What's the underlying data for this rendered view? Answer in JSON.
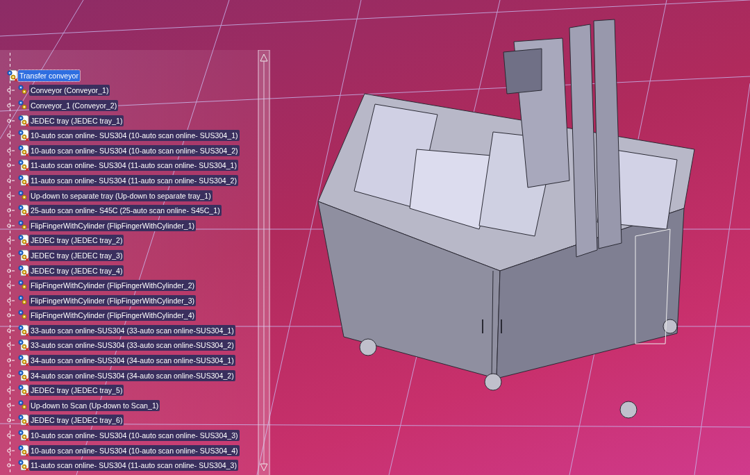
{
  "tree": {
    "label": "Transfer conveyor",
    "selected": true,
    "children": [
      {
        "label": "Conveyor (Conveyor_1)",
        "kind": "component",
        "selected": false
      },
      {
        "label": "Conveyor_1 (Conveyor_2)",
        "kind": "component",
        "selected": false
      },
      {
        "label": "JEDEC tray (JEDEC tray_1)",
        "kind": "part",
        "selected": false
      },
      {
        "label": "10-auto scan online- SUS304 (10-auto scan online- SUS304_1)",
        "kind": "part",
        "selected": false
      },
      {
        "label": "10-auto scan online- SUS304 (10-auto scan online- SUS304_2)",
        "kind": "part",
        "selected": false
      },
      {
        "label": "11-auto scan online- SUS304 (11-auto scan online- SUS304_1)",
        "kind": "part",
        "selected": false
      },
      {
        "label": "11-auto scan online- SUS304 (11-auto scan online- SUS304_2)",
        "kind": "part",
        "selected": false
      },
      {
        "label": "Up-down to separate tray (Up-down to separate tray_1)",
        "kind": "component",
        "selected": false
      },
      {
        "label": "25-auto scan online- S45C (25-auto scan online- S45C_1)",
        "kind": "part",
        "selected": false
      },
      {
        "label": "FlipFingerWithCylinder (FlipFingerWithCylinder_1)",
        "kind": "component",
        "selected": false
      },
      {
        "label": "JEDEC tray (JEDEC tray_2)",
        "kind": "part",
        "selected": false
      },
      {
        "label": "JEDEC tray (JEDEC tray_3)",
        "kind": "part",
        "selected": false
      },
      {
        "label": "JEDEC tray (JEDEC tray_4)",
        "kind": "part",
        "selected": false
      },
      {
        "label": "FlipFingerWithCylinder (FlipFingerWithCylinder_2)",
        "kind": "component",
        "selected": false
      },
      {
        "label": "FlipFingerWithCylinder (FlipFingerWithCylinder_3)",
        "kind": "component",
        "selected": false
      },
      {
        "label": "FlipFingerWithCylinder (FlipFingerWithCylinder_4)",
        "kind": "component",
        "selected": false
      },
      {
        "label": "33-auto scan online-SUS304 (33-auto scan online-SUS304_1)",
        "kind": "part",
        "selected": false
      },
      {
        "label": "33-auto scan online-SUS304 (33-auto scan online-SUS304_2)",
        "kind": "part",
        "selected": false
      },
      {
        "label": "34-auto scan online-SUS304 (34-auto scan online-SUS304_1)",
        "kind": "part",
        "selected": false
      },
      {
        "label": "34-auto scan online-SUS304 (34-auto scan online-SUS304_2)",
        "kind": "part",
        "selected": false
      },
      {
        "label": "JEDEC tray (JEDEC tray_5)",
        "kind": "part",
        "selected": false
      },
      {
        "label": "Up-down to Scan (Up-down to Scan_1)",
        "kind": "component",
        "selected": false
      },
      {
        "label": "JEDEC tray (JEDEC tray_6)",
        "kind": "part",
        "selected": false
      },
      {
        "label": "10-auto scan online- SUS304 (10-auto scan online- SUS304_3)",
        "kind": "part",
        "selected": false
      },
      {
        "label": "10-auto scan online- SUS304 (10-auto scan online- SUS304_4)",
        "kind": "part",
        "selected": false
      },
      {
        "label": "11-auto scan online- SUS304 (11-auto scan online- SUS304_3)",
        "kind": "part",
        "selected": false
      }
    ]
  }
}
